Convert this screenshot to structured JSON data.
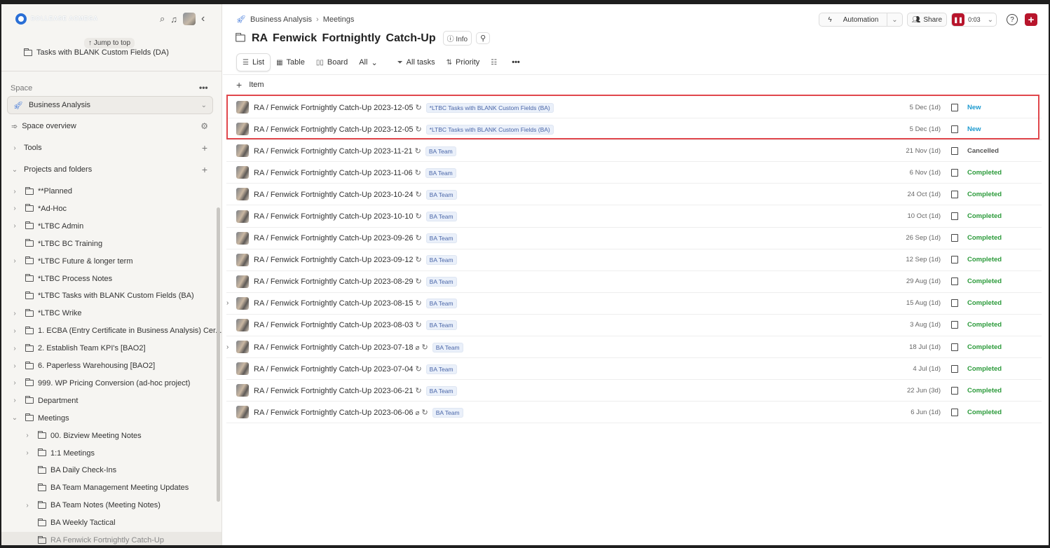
{
  "sidebar": {
    "logo_text": "BOLLEASE ACMEGA",
    "jump_to_top": "Jump to top",
    "top_item": "Tasks with BLANK Custom Fields (DA)",
    "space_label": "Space",
    "space_dots": "•••",
    "space_select": "Business Analysis",
    "nav": {
      "space_overview": "Space overview",
      "tools": "Tools",
      "projects_and_folders": "Projects and folders"
    },
    "folders": [
      {
        "label": "**Planned",
        "expandable": true,
        "indent": 0
      },
      {
        "label": "*Ad-Hoc",
        "expandable": true,
        "indent": 0
      },
      {
        "label": "*LTBC Admin",
        "expandable": true,
        "indent": 0
      },
      {
        "label": "*LTBC BC Training",
        "expandable": false,
        "indent": 0
      },
      {
        "label": "*LTBC Future & longer term",
        "expandable": true,
        "indent": 0
      },
      {
        "label": "*LTBC Process Notes",
        "expandable": false,
        "indent": 0
      },
      {
        "label": "*LTBC Tasks with BLANK Custom Fields (BA)",
        "expandable": false,
        "indent": 0
      },
      {
        "label": "*LTBC Wrike",
        "expandable": true,
        "indent": 0
      },
      {
        "label": "1. ECBA (Entry Certificate in Business Analysis) Cer...",
        "expandable": true,
        "indent": 0
      },
      {
        "label": "2. Establish Team KPI's [BAO2]",
        "expandable": true,
        "indent": 0
      },
      {
        "label": "6. Paperless Warehousing [BAO2]",
        "expandable": true,
        "indent": 0
      },
      {
        "label": "999. WP Pricing Conversion (ad-hoc project)",
        "expandable": true,
        "indent": 0
      },
      {
        "label": "Department",
        "expandable": true,
        "indent": 0
      },
      {
        "label": "Meetings",
        "expandable": true,
        "expanded": true,
        "indent": 0
      },
      {
        "label": "00. Bizview Meeting Notes",
        "expandable": true,
        "indent": 1
      },
      {
        "label": "1:1 Meetings",
        "expandable": true,
        "indent": 1
      },
      {
        "label": "BA Daily Check-Ins",
        "expandable": false,
        "indent": 1
      },
      {
        "label": "BA Team Management Meeting Updates",
        "expandable": false,
        "indent": 1
      },
      {
        "label": "BA Team Notes (Meeting Notes)",
        "expandable": true,
        "indent": 1
      },
      {
        "label": "BA Weekly Tactical",
        "expandable": false,
        "indent": 1
      },
      {
        "label": "RA Fenwick Fortnightly Catch-Up",
        "expandable": false,
        "indent": 1,
        "active": true
      }
    ]
  },
  "header": {
    "breadcrumb": [
      "Business Analysis",
      "Meetings"
    ],
    "title": "RA  Fenwick Fortnightly Catch-Up",
    "info": "Info",
    "automation": "Automation",
    "share": "Share",
    "timer": "0:03",
    "help": "?",
    "add": "+"
  },
  "views": {
    "list": "List",
    "table": "Table",
    "board": "Board",
    "all": "All",
    "all_tasks": "All tasks",
    "priority": "Priority"
  },
  "add_item": "Item",
  "colors": {
    "accent_red": "#b8152c",
    "status_new": "#1e9bd0",
    "status_completed": "#2b9a3a",
    "highlight": "#e0474c"
  },
  "tasks": [
    {
      "name": "RA / Fenwick Fortnightly Catch-Up 2023-12-05",
      "tag": "*LTBC Tasks with BLANK Custom Fields (BA)",
      "date": "5 Dec (1d)",
      "status": "New",
      "status_class": "st-new"
    },
    {
      "name": "RA / Fenwick Fortnightly Catch-Up 2023-12-05",
      "tag": "*LTBC Tasks with BLANK Custom Fields (BA)",
      "date": "5 Dec (1d)",
      "status": "New",
      "status_class": "st-new"
    },
    {
      "name": "RA / Fenwick Fortnightly Catch-Up 2023-11-21",
      "tag": "BA Team",
      "date": "21 Nov (1d)",
      "status": "Cancelled",
      "status_class": "st-cancelled"
    },
    {
      "name": "RA / Fenwick Fortnightly Catch-Up 2023-11-06",
      "tag": "BA Team",
      "date": "6 Nov (1d)",
      "status": "Completed",
      "status_class": "st-completed"
    },
    {
      "name": "RA / Fenwick Fortnightly Catch-Up 2023-10-24",
      "tag": "BA Team",
      "date": "24 Oct (1d)",
      "status": "Completed",
      "status_class": "st-completed"
    },
    {
      "name": "RA / Fenwick Fortnightly Catch-Up 2023-10-10",
      "tag": "BA Team",
      "date": "10 Oct (1d)",
      "status": "Completed",
      "status_class": "st-completed"
    },
    {
      "name": "RA / Fenwick Fortnightly Catch-Up 2023-09-26",
      "tag": "BA Team",
      "date": "26 Sep (1d)",
      "status": "Completed",
      "status_class": "st-completed"
    },
    {
      "name": "RA / Fenwick Fortnightly Catch-Up 2023-09-12",
      "tag": "BA Team",
      "date": "12 Sep (1d)",
      "status": "Completed",
      "status_class": "st-completed"
    },
    {
      "name": "RA / Fenwick Fortnightly Catch-Up 2023-08-29",
      "tag": "BA Team",
      "date": "29 Aug (1d)",
      "status": "Completed",
      "status_class": "st-completed"
    },
    {
      "name": "RA / Fenwick Fortnightly Catch-Up 2023-08-15",
      "tag": "BA Team",
      "date": "15 Aug (1d)",
      "status": "Completed",
      "status_class": "st-completed",
      "expandable": true
    },
    {
      "name": "RA / Fenwick Fortnightly Catch-Up 2023-08-03",
      "tag": "BA Team",
      "date": "3 Aug (1d)",
      "status": "Completed",
      "status_class": "st-completed"
    },
    {
      "name": "RA / Fenwick Fortnightly Catch-Up 2023-07-18",
      "tag": "BA Team",
      "date": "18 Jul (1d)",
      "status": "Completed",
      "status_class": "st-completed",
      "expandable": true,
      "attachment": true
    },
    {
      "name": "RA / Fenwick Fortnightly Catch-Up 2023-07-04",
      "tag": "BA Team",
      "date": "4 Jul (1d)",
      "status": "Completed",
      "status_class": "st-completed"
    },
    {
      "name": "RA / Fenwick Fortnightly Catch-Up 2023-06-21",
      "tag": "BA Team",
      "date": "22 Jun (3d)",
      "status": "Completed",
      "status_class": "st-completed"
    },
    {
      "name": "RA / Fenwick Fortnightly Catch-Up 2023-06-06",
      "tag": "BA Team",
      "date": "6 Jun (1d)",
      "status": "Completed",
      "status_class": "st-completed",
      "attachment": true
    }
  ]
}
